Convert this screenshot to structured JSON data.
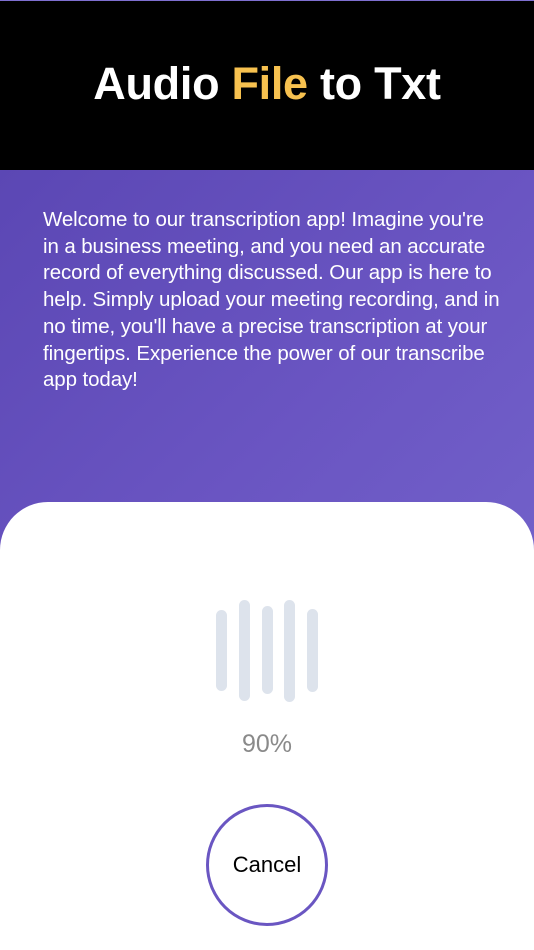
{
  "header": {
    "title_part1": "Audio ",
    "title_accent": "File",
    "title_part2": " to Txt",
    "accent_color": "#f7c14f",
    "background_color": "#000000"
  },
  "intro": {
    "text": "Welcome to our transcription app! Imagine you're in a business meeting, and you need an accurate record of everything discussed. Our app is here to help. Simply upload your meeting recording, and in no time, you'll have a precise transcription at your fingertips. Experience the power of our transcribe app today!",
    "gradient_colors": [
      "#5b47b4",
      "#7160c9"
    ]
  },
  "progress": {
    "icon": "audio-waveform-icon",
    "waveform_color": "#dde3ec",
    "value": 0.9,
    "label": "90%"
  },
  "actions": {
    "cancel_label": "Cancel",
    "cancel_border_color": "#6a56c2"
  }
}
